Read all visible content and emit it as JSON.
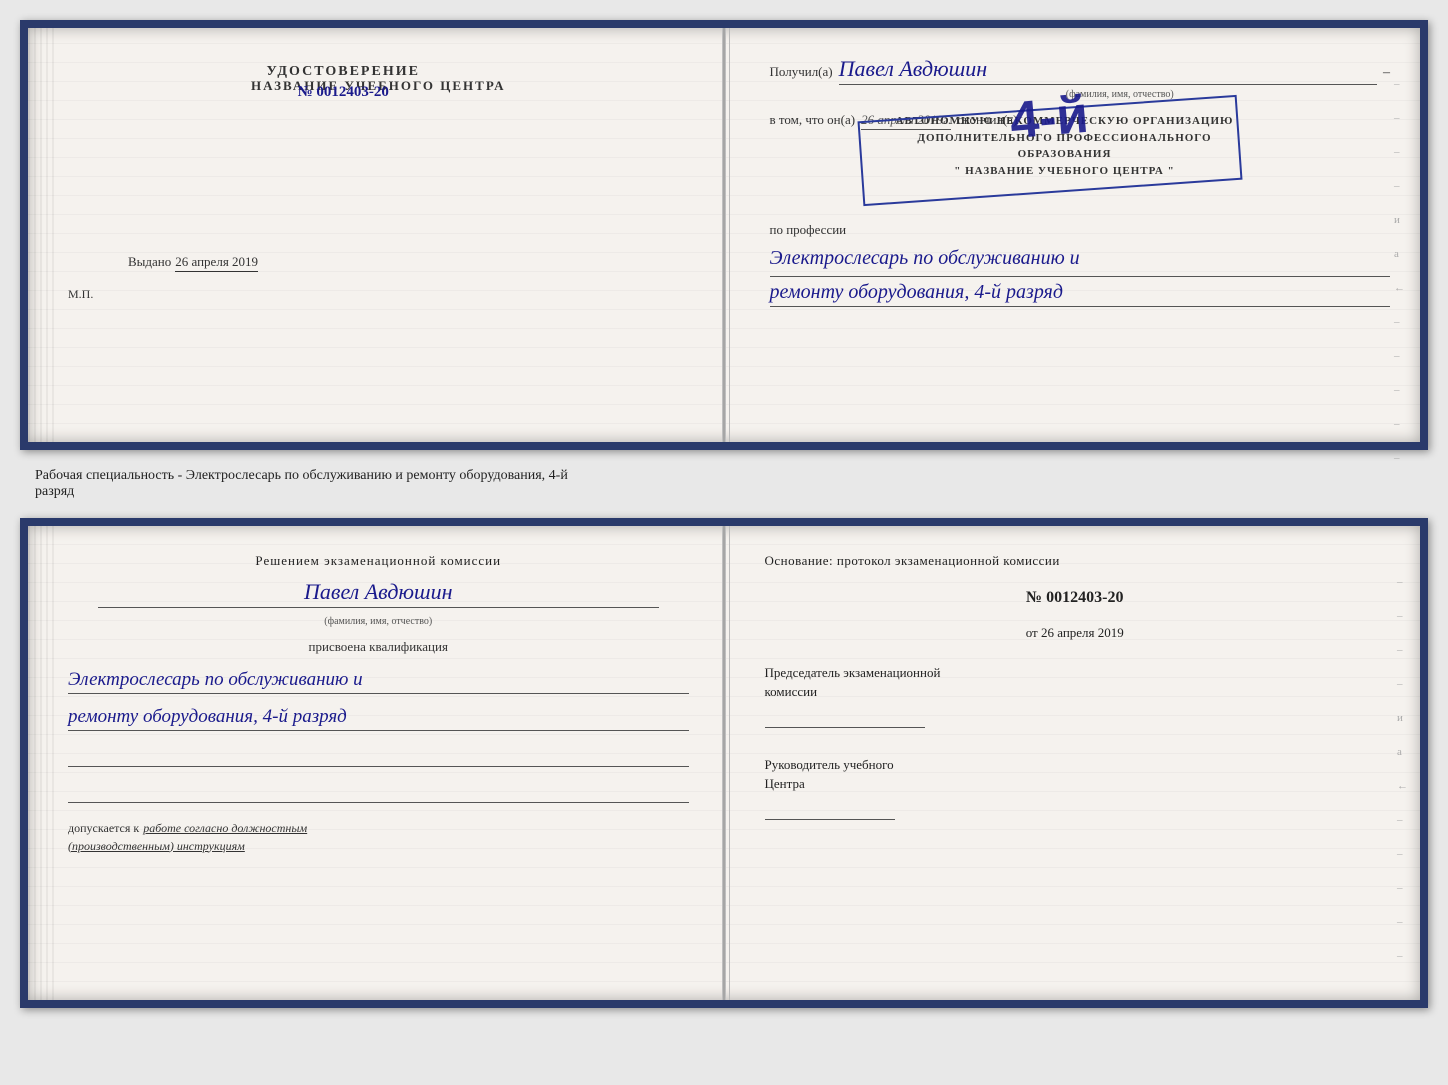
{
  "top_left": {
    "title": "НАЗВАНИЕ УЧЕБНОГО ЦЕНТРА",
    "udostoverenie_label": "УДОСТОВЕРЕНИЕ",
    "number": "№ 0012403-20",
    "vydano_label": "Выдано",
    "vydano_date": "26 апреля 2019",
    "mp_label": "М.П."
  },
  "top_right": {
    "poluchil_label": "Получил(а)",
    "name_handwritten": "Павел Авдюшин",
    "dash": "–",
    "fio_hint": "(фамилия, имя, отчество)",
    "vtom_label": "в том, что он(а)",
    "date_italic": "26 апреля 2019г.",
    "okonchil_label": "окончил(а)",
    "stamp_line1": "АВТОНОМНУЮ НЕКОММЕРЧЕСКУЮ ОРГАНИЗАЦИЮ",
    "stamp_line2": "ДОПОЛНИТЕЛЬНОГО ПРОФЕССИОНАЛЬНОГО ОБРАЗОВАНИЯ",
    "stamp_line3": "\" НАЗВАНИЕ УЧЕБНОГО ЦЕНТРА \"",
    "razryad_big": "4-й",
    "po_professii_label": "по профессии",
    "profession_line1": "Электрослесарь по обслуживанию и",
    "profession_line2": "ремонту оборудования, 4-й разряд",
    "side_dashes": [
      "–",
      "–",
      "–",
      "–",
      "и",
      "а",
      "←",
      "–",
      "–",
      "–",
      "–",
      "–"
    ]
  },
  "middle_text": "Рабочая специальность - Электрослесарь по обслуживанию и ремонту оборудования, 4-й\nразряд",
  "bottom_left": {
    "resheniye_label": "Решением экзаменационной комиссии",
    "name_handwritten": "Павел Авдюшин",
    "fio_hint": "(фамилия, имя, отчество)",
    "prisvoena_label": "присвоена квалификация",
    "profession_line1": "Электрослесарь по обслуживанию и",
    "profession_line2": "ремонту оборудования, 4-й разряд",
    "dopuskaetsya_label": "допускается к",
    "dopuskaetsya_underlined": "работе согласно должностным\n(производственным) инструкциям"
  },
  "bottom_right": {
    "osnovanie_label": "Основание: протокол экзаменационной комиссии",
    "number": "№  0012403-20",
    "ot_label": "от",
    "ot_date": "26 апреля 2019",
    "chairman_label": "Председатель экзаменационной\nкомиссии",
    "rukov_label": "Руководитель учебного\nЦентра",
    "side_dashes": [
      "–",
      "–",
      "–",
      "–",
      "и",
      "а",
      "←",
      "–",
      "–",
      "–",
      "–",
      "–"
    ]
  }
}
